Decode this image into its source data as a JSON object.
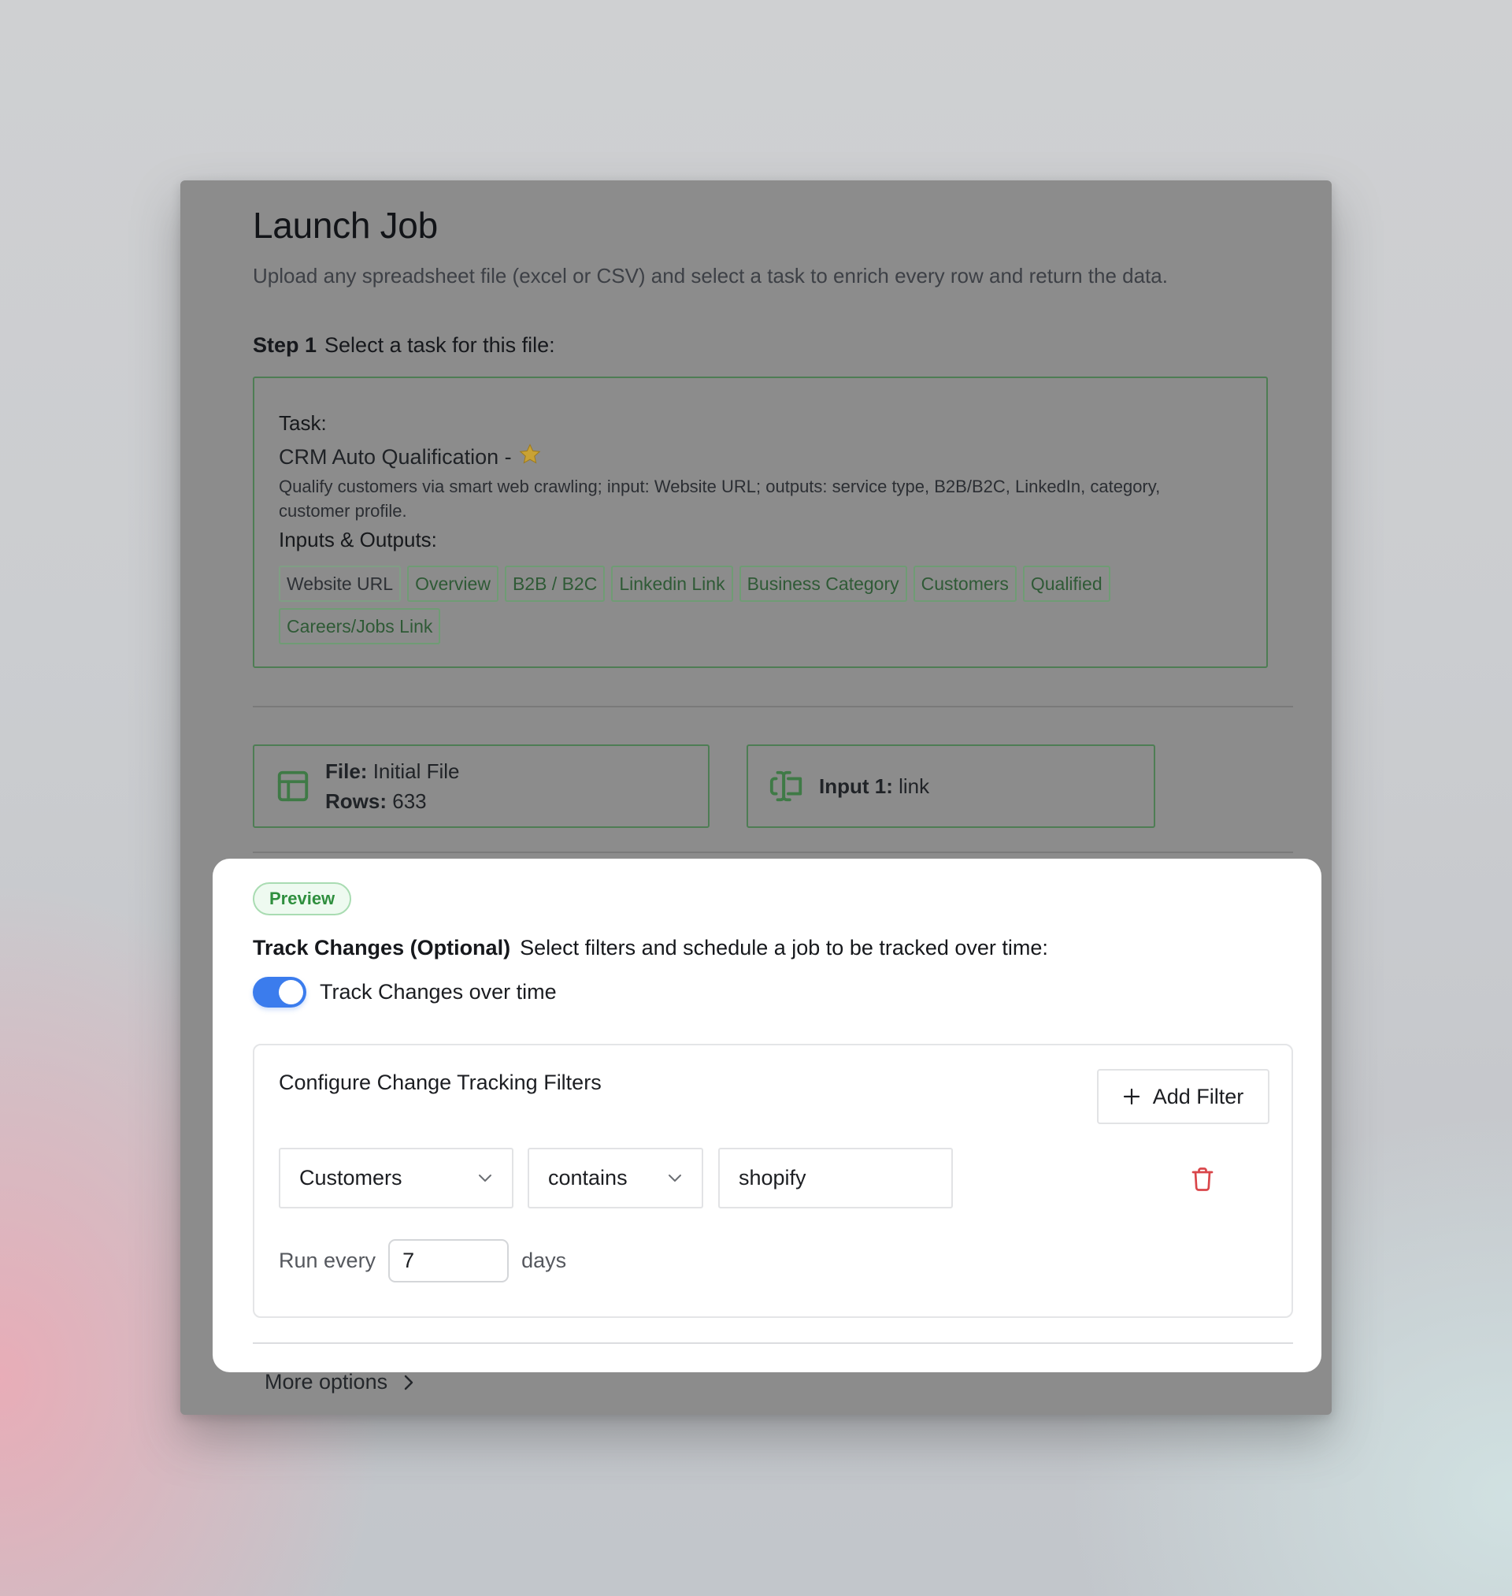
{
  "header": {
    "title": "Launch Job",
    "subtitle": "Upload any spreadsheet file (excel or CSV) and select a task to enrich every row and return the data."
  },
  "step1": {
    "label": "Step 1",
    "text": "Select a task for this file:"
  },
  "task": {
    "label": "Task:",
    "name": "CRM Auto Qualification -",
    "name_icon": "star-icon",
    "description": "Qualify customers via smart web crawling; input: Website URL; outputs: service type, B2B/B2C, LinkedIn, category, customer profile.",
    "io_label": "Inputs & Outputs:",
    "tags": [
      {
        "label": "Website URL",
        "kind": "input"
      },
      {
        "label": "Overview",
        "kind": "output"
      },
      {
        "label": "B2B / B2C",
        "kind": "output"
      },
      {
        "label": "Linkedin Link",
        "kind": "output"
      },
      {
        "label": "Business Category",
        "kind": "output"
      },
      {
        "label": "Customers",
        "kind": "output"
      },
      {
        "label": "Qualified",
        "kind": "output"
      },
      {
        "label": "Careers/Jobs Link",
        "kind": "output"
      }
    ]
  },
  "file_card": {
    "icon": "table-icon",
    "file_label": "File:",
    "file_value": "Initial File",
    "rows_label": "Rows:",
    "rows_value": "633"
  },
  "input_card": {
    "icon": "text-cursor-input-icon",
    "label": "Input 1:",
    "value": "link"
  },
  "track_changes": {
    "badge": "Preview",
    "heading": "Track Changes (Optional)",
    "description": "Select filters and schedule a job to be tracked over time:",
    "toggle_label": "Track Changes over time",
    "toggle_on": true,
    "filters_title": "Configure Change Tracking Filters",
    "add_filter_label": "Add Filter",
    "filter": {
      "field": "Customers",
      "operator": "contains",
      "value": "shopify"
    },
    "run_every_label": "Run every",
    "run_every_value": "7",
    "run_every_unit": "days"
  },
  "footer": {
    "more_options": "More options"
  },
  "colors": {
    "accent_blue": "#3b7ced",
    "green": "#4e7d54",
    "badge_green": "#2f8f3e",
    "danger_red": "#d9464a",
    "overlay_gray": "#8c8c8c"
  }
}
